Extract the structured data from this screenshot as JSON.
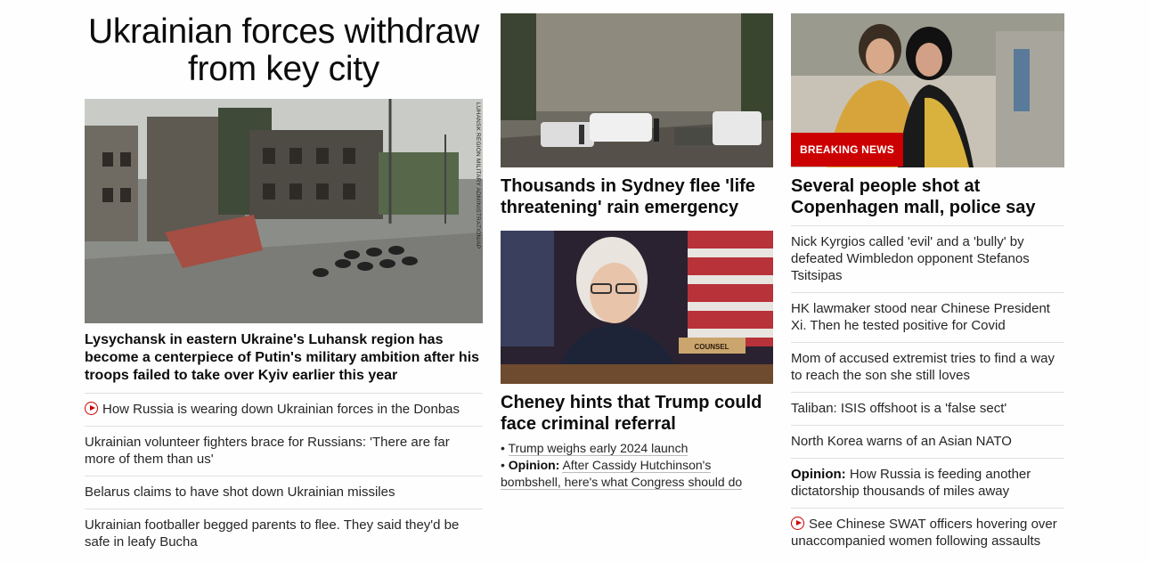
{
  "lead": {
    "headline": "Ukrainian forces withdraw from key city",
    "image_credit": "LUHANSK REGION MILITARY ADMINISTRATION/AP",
    "description": "Lysychansk in eastern Ukraine's Luhansk region has become a centerpiece of Putin's military ambition after his troops failed to take over Kyiv earlier this year",
    "links": [
      {
        "text": "How Russia is wearing down Ukrainian forces in the Donbas",
        "video": true
      },
      {
        "text": "Ukrainian volunteer fighters brace for Russians: 'There are far more of them than us'",
        "video": false
      },
      {
        "text": "Belarus claims to have shot down Ukrainian missiles",
        "video": false
      },
      {
        "text": "Ukrainian footballer begged parents to flee. They said they'd be safe in leafy Bucha",
        "video": false
      }
    ]
  },
  "middle": {
    "sydney_title": "Thousands in Sydney flee 'life threatening' rain emergency",
    "cheney_title": "Cheney hints that Trump could face criminal referral",
    "bullet1": "Trump weighs early 2024 launch",
    "bullet2_prefix": "Opinion:",
    "bullet2_text": "After Cassidy Hutchinson's bombshell, here's what Congress should do",
    "counsel_sign": "COUNSEL"
  },
  "right": {
    "badge": "BREAKING NEWS",
    "title": "Several people shot at Copenhagen mall, police say",
    "links": [
      {
        "text": "Nick Kyrgios called 'evil' and a 'bully' by defeated Wimbledon opponent Stefanos Tsitsipas"
      },
      {
        "text": "HK lawmaker stood near Chinese President Xi. Then he tested positive for Covid"
      },
      {
        "text": "Mom of accused extremist tries to find a way to reach the son she still loves"
      },
      {
        "text": "Taliban: ISIS offshoot is a 'false sect'"
      },
      {
        "text": "North Korea warns of an Asian NATO"
      },
      {
        "prefix": "Opinion:",
        "text": "How Russia is feeding another dictatorship thousands of miles away"
      },
      {
        "text": "See Chinese SWAT officers hovering over unaccompanied women following assaults",
        "video": true
      }
    ]
  },
  "colors": {
    "accent": "#cc0000",
    "divider": "#e0e0e0",
    "text": "#0c0c0c"
  }
}
